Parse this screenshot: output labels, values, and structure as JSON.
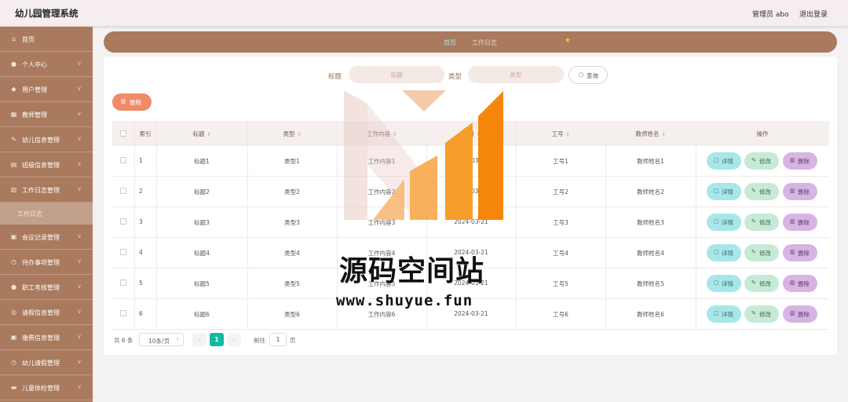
{
  "app": {
    "title": "幼儿园管理系统"
  },
  "header": {
    "admin_label": "管理员 abo",
    "logout_label": "退出登录"
  },
  "sidebar": {
    "items": [
      {
        "label": "首页",
        "icon": "home-icon",
        "glyph": "⌂",
        "chevron": false
      },
      {
        "label": "个人中心",
        "icon": "user-icon",
        "glyph": "●",
        "chevron": true
      },
      {
        "label": "用户管理",
        "icon": "pin-icon",
        "glyph": "◆",
        "chevron": true
      },
      {
        "label": "教师管理",
        "icon": "grid-icon",
        "glyph": "▦",
        "chevron": true
      },
      {
        "label": "幼儿信息管理",
        "icon": "leaf-icon",
        "glyph": "✎",
        "chevron": true
      },
      {
        "label": "班级信息管理",
        "icon": "list-icon",
        "glyph": "▤",
        "chevron": true
      },
      {
        "label": "工作日志管理",
        "icon": "chart-icon",
        "glyph": "▥",
        "chevron": true
      },
      {
        "label": "会议记录管理",
        "icon": "doc-icon",
        "glyph": "▣",
        "chevron": true
      },
      {
        "label": "待办事项管理",
        "icon": "clock-icon",
        "glyph": "◷",
        "chevron": true
      },
      {
        "label": "职工考核管理",
        "icon": "person-icon",
        "glyph": "●",
        "chevron": true
      },
      {
        "label": "请假信息管理",
        "icon": "globe-icon",
        "glyph": "◎",
        "chevron": true
      },
      {
        "label": "缴费信息管理",
        "icon": "wallet-icon",
        "glyph": "▣",
        "chevron": true
      },
      {
        "label": "幼儿请假管理",
        "icon": "calendar-icon",
        "glyph": "◷",
        "chevron": true
      },
      {
        "label": "儿童体检管理",
        "icon": "card-icon",
        "glyph": "▬",
        "chevron": true
      }
    ],
    "active_sub": "工作日志"
  },
  "breadcrumb": {
    "home": "首页",
    "current": "工作日志"
  },
  "search": {
    "title_label": "标题",
    "title_placeholder": "标题",
    "type_label": "类型",
    "type_placeholder": "类型",
    "button_label": "查询"
  },
  "actions": {
    "delete_label": "删除"
  },
  "table": {
    "headers": [
      "索引",
      "标题",
      "类型",
      "工作内容",
      "日期",
      "工号",
      "教师姓名",
      "操作"
    ],
    "rows": [
      [
        "1",
        "标题1",
        "类型1",
        "工作内容1",
        "2024-03-21",
        "工号1",
        "教师姓名1"
      ],
      [
        "2",
        "标题2",
        "类型2",
        "工作内容2",
        "2024-03-21",
        "工号2",
        "教师姓名2"
      ],
      [
        "3",
        "标题3",
        "类型3",
        "工作内容3",
        "2024-03-21",
        "工号3",
        "教师姓名3"
      ],
      [
        "4",
        "标题4",
        "类型4",
        "工作内容4",
        "2024-03-21",
        "工号4",
        "教师姓名4"
      ],
      [
        "5",
        "标题5",
        "类型5",
        "工作内容5",
        "2024-03-21",
        "工号5",
        "教师姓名5"
      ],
      [
        "6",
        "标题6",
        "类型6",
        "工作内容6",
        "2024-03-21",
        "工号6",
        "教师姓名6"
      ]
    ],
    "row_actions": {
      "detail": "详情",
      "edit": "修改",
      "delete": "删除"
    }
  },
  "pagination": {
    "total_text": "共 6 条",
    "page_size": "10条/页",
    "current_page": "1",
    "goto_label": "前往",
    "goto_value": "1",
    "page_unit": "页"
  },
  "watermark": {
    "title": "源码空间站",
    "url": "www.shuyue.fun"
  },
  "colors": {
    "brand": "#a97a5e",
    "delete": "#f08a68",
    "detail": "#a7e7e9",
    "edit": "#c6ead6",
    "row_delete": "#d7b4e3",
    "page_active": "#12b8a0"
  }
}
